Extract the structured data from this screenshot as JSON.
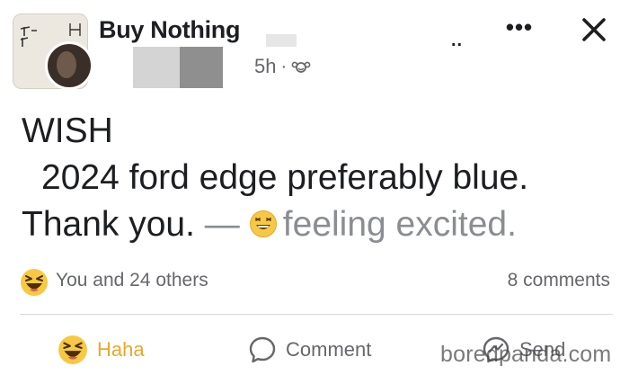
{
  "header": {
    "group_name": "Buy Nothing",
    "timestamp": "5h",
    "separator": "·",
    "audience_icon": "group-audience-icon",
    "small_dots": "..",
    "more_label": "•••",
    "close_icon": "close-icon"
  },
  "post": {
    "line1": "WISH",
    "line2": "2024 ford edge preferably blue.",
    "line3": "Thank you.",
    "dash": "—",
    "feeling_text": "feeling excited."
  },
  "reactions": {
    "summary": "You and 24 others",
    "comments": "8 comments",
    "icon": "haha-emoji-icon"
  },
  "actions": {
    "haha_label": "Haha",
    "comment_label": "Comment",
    "send_label": "Send"
  },
  "watermark": "boredpanda.com",
  "colors": {
    "haha_accent": "#e8a92a",
    "secondary_text": "#65676b",
    "feeling_text": "#8a8d91"
  }
}
